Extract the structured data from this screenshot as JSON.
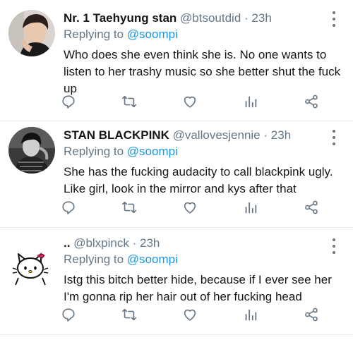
{
  "tweets": [
    {
      "display_name": "Nr. 1 Taehyung stan",
      "handle": "@btsoutdid",
      "separator": "·",
      "time": "23h",
      "replying_prefix": "Replying to",
      "replying_to": "@soompi",
      "text": "Who does she even think she is. No one wants to listen to her trashy music so she better shut the fuck up"
    },
    {
      "display_name": "STAN BLACKPINK",
      "handle": "@vallovesjennie",
      "separator": "·",
      "time": "23h",
      "replying_prefix": "Replying to",
      "replying_to": "@soompi",
      "text": "She has the fucking audacity to call blackpink ugly. Like girl, look in the mirror and kys after that"
    },
    {
      "display_name": "..",
      "handle": "@blxpinck",
      "separator": "·",
      "time": "23h",
      "replying_prefix": "Replying to",
      "replying_to": "@soompi",
      "text": "Istg this bitch better hide, because if I ever see her I'm gonna rip her hair out of her fucking head"
    }
  ],
  "icons": [
    "reply-icon",
    "retweet-icon",
    "like-icon",
    "analytics-icon",
    "share-icon",
    "more-options-icon"
  ],
  "colors": {
    "text": "#14171a",
    "secondary": "#657786",
    "link": "#1b95e0",
    "divider": "#e6ecf0",
    "hello_kitty_bow": "#e0245e"
  }
}
